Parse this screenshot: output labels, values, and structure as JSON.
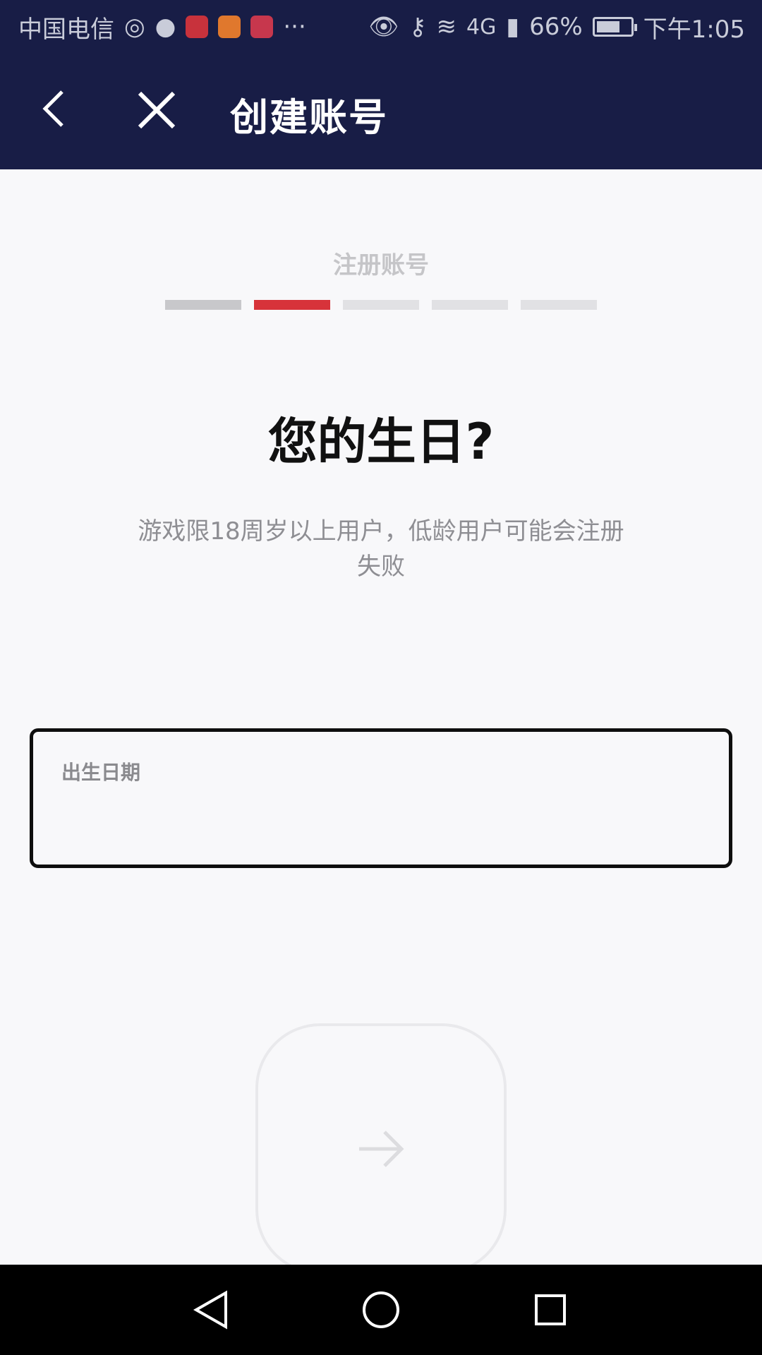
{
  "status_bar": {
    "carrier": "中国电信",
    "network": "4G",
    "battery": "66%",
    "time": "下午1:05",
    "more": "···"
  },
  "header": {
    "title": "创建账号"
  },
  "steps": {
    "label": "注册账号",
    "count": 5,
    "current": 2
  },
  "question": {
    "title": "您的生日?",
    "subtitle_line1": "游戏限18周岁以上用户，低龄用户可能会注册",
    "subtitle_line2": "失败"
  },
  "dob": {
    "label": "出生日期",
    "value": ""
  },
  "colors": {
    "header_bg": "#181d46",
    "accent": "#d7333a",
    "page_bg": "#f8f8fa"
  }
}
